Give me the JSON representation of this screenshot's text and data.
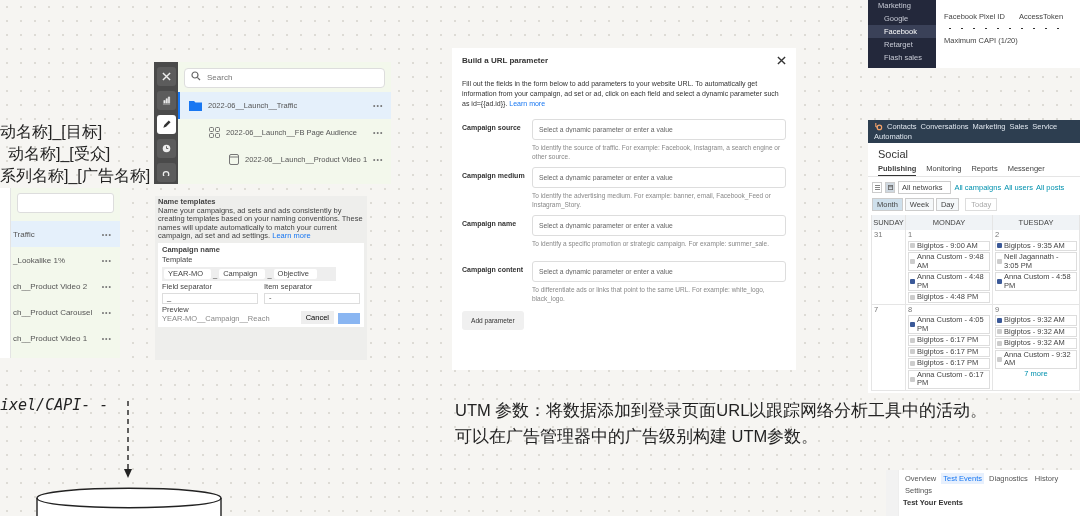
{
  "naming_notes": [
    "动名称]_[目标]",
    "动名称]_[受众]",
    "系列名称]_[广告名称]"
  ],
  "left_panel": {
    "rows": [
      {
        "label": "Traffic",
        "more": "•••",
        "selected": true
      },
      {
        "label": "_Lookalike 1%",
        "more": "•••",
        "selected": false
      },
      {
        "label": "ch__Product Video 2",
        "more": "•••",
        "selected": false
      },
      {
        "label": "ch__Product Carousel",
        "more": "•••",
        "selected": false
      },
      {
        "label": "ch__Product Video 1",
        "more": "•••",
        "selected": false
      }
    ]
  },
  "campaign_tree": {
    "search_placeholder": "Search",
    "tools": [
      {
        "kind": "close",
        "selected": false
      },
      {
        "kind": "chart",
        "selected": false
      },
      {
        "kind": "edit",
        "selected": true
      },
      {
        "kind": "history",
        "selected": false
      },
      {
        "kind": "search",
        "selected": false
      }
    ],
    "items": [
      {
        "label": "2022-06__Launch__Traffic",
        "more": "•••",
        "selected": true,
        "children": [
          {
            "label": "2022-06__Launch__FB Page Audience",
            "more": "•••",
            "selected": false,
            "children": [
              {
                "label": "2022-06__Launch__Product Video 1",
                "more": "•••",
                "selected": false
              }
            ]
          }
        ]
      }
    ]
  },
  "name_templates": {
    "title": "Name templates",
    "intro": "Name your campaigns, ad sets and ads consistently by creating templates based on your naming conventions. These names will update automatically to match your current campaign, ad set and ad settings.",
    "learn_more": "Learn more",
    "section": "Campaign name",
    "template_label": "Template",
    "chips": [
      "YEAR-MO",
      "Campaign",
      "Objective"
    ],
    "joiner": "_",
    "field_separator_label": "Field separator",
    "field_separator": "_",
    "item_separator_label": "Item separator",
    "item_separator": "-",
    "preview_label": "Preview",
    "preview": "YEAR-MO__Campaign__Reach",
    "cancel": "Cancel"
  },
  "url_parameter_dialog": {
    "title": "Build a URL parameter",
    "intro": "Fill out the fields in the form below to add parameters to your website URL. To automatically get information from your campaign, ad set or ad, click on each field and select a dynamic parameter such as id={{ad.id}}.",
    "learn_more": "Learn more",
    "fields": [
      {
        "label": "Campaign source",
        "placeholder": "Select a dynamic parameter or enter a value",
        "help": "To identify the source of traffic. For example: Facebook, Instagram, a search engine or other source."
      },
      {
        "label": "Campaign medium",
        "placeholder": "Select a dynamic parameter or enter a value",
        "help": "To identify the advertising medium. For example: banner, email, Facebook_Feed or Instagram_Story."
      },
      {
        "label": "Campaign name",
        "placeholder": "Select a dynamic parameter or enter a value",
        "help": "To identify a specific promotion or strategic campaign. For example: summer_sale."
      },
      {
        "label": "Campaign content",
        "placeholder": "Select a dynamic parameter or enter a value",
        "help": "To differentiate ads or links that point to the same URL. For example: white_logo, black_logo."
      }
    ],
    "add_button": "Add parameter"
  },
  "pixel_settings": {
    "menu": [
      {
        "label": "Marketing",
        "selected": false
      },
      {
        "label": "Google",
        "selected": false
      },
      {
        "label": "Facebook",
        "selected": true
      },
      {
        "label": "Retarget",
        "selected": false
      },
      {
        "label": "Flash sales",
        "selected": false
      }
    ],
    "fields": [
      "Facebook Pixel ID",
      "AccessToken"
    ],
    "note": "Maximum CAPI (1/20)"
  },
  "social": {
    "nav": [
      "Contacts",
      "Conversations",
      "Marketing",
      "Sales",
      "Service",
      "Automation"
    ],
    "title": "Social",
    "tabs": [
      {
        "label": "Publishing",
        "selected": true
      },
      {
        "label": "Monitoring",
        "selected": false
      },
      {
        "label": "Reports",
        "selected": false
      },
      {
        "label": "Messenger",
        "selected": false
      }
    ],
    "view_toggle": [
      {
        "kind": "list",
        "selected": false
      },
      {
        "kind": "calendar",
        "selected": true
      }
    ],
    "network_filter": "All networks",
    "filters": [
      "All campaigns",
      "All users",
      "All posts"
    ],
    "views": [
      {
        "label": "Month",
        "selected": true
      },
      {
        "label": "Week",
        "selected": false
      },
      {
        "label": "Day",
        "selected": false
      }
    ],
    "today": "Today",
    "days": [
      "SUNDAY",
      "MONDAY",
      "TUESDAY"
    ],
    "weeks": [
      {
        "cells": [
          {
            "date": "31"
          },
          {
            "date": "1",
            "posts": [
              {
                "text": "Bigiptos - 9:00 AM",
                "kind": "other"
              },
              {
                "text": "Anna Custom - 9:48 AM",
                "kind": "other"
              },
              {
                "text": "Anna Custom - 4:48 PM",
                "kind": "facebook"
              },
              {
                "text": "Bigiptos - 4:48 PM",
                "kind": "other"
              }
            ]
          },
          {
            "date": "2",
            "posts": [
              {
                "text": "Bigiptos - 9:35 AM",
                "kind": "facebook"
              },
              {
                "text": "Neil Jagannath - 3:05 PM",
                "kind": "other"
              },
              {
                "text": "Anna Custom - 4:58 PM",
                "kind": "facebook"
              }
            ]
          }
        ]
      },
      {
        "cells": [
          {
            "date": "7"
          },
          {
            "date": "8",
            "posts": [
              {
                "text": "Anna Custom - 4:05 PM",
                "kind": "facebook"
              },
              {
                "text": "Bigiptos - 6:17 PM",
                "kind": "other"
              },
              {
                "text": "Bigiptos - 6:17 PM",
                "kind": "other"
              },
              {
                "text": "Bigiptos - 6:17 PM",
                "kind": "other"
              },
              {
                "text": "Anna Custom - 6:17 PM",
                "kind": "other"
              }
            ]
          },
          {
            "date": "9",
            "posts": [
              {
                "text": "Bigiptos - 9:32 AM",
                "kind": "facebook"
              },
              {
                "text": "Bigiptos - 9:32 AM",
                "kind": "other"
              },
              {
                "text": "Bigiptos - 9:32 AM",
                "kind": "other"
              },
              {
                "text": "Anna Custom - 9:32 AM",
                "kind": "other"
              }
            ],
            "more": "7 more"
          }
        ]
      }
    ]
  },
  "handwritten_label": "ixel/CAPI- -",
  "caption": [
    "UTM 参数：将数据添加到登录页面URL以跟踪网络分析工具中的活动。",
    "可以在广告管理器中的广告级别构建 UTM参数。"
  ],
  "events_manager": {
    "tabs": [
      {
        "label": "Overview",
        "selected": false
      },
      {
        "label": "Test Events",
        "selected": true
      },
      {
        "label": "Diagnostics",
        "selected": false
      },
      {
        "label": "History",
        "selected": false
      },
      {
        "label": "Settings",
        "selected": false
      }
    ],
    "heading": "Test Your Events"
  }
}
